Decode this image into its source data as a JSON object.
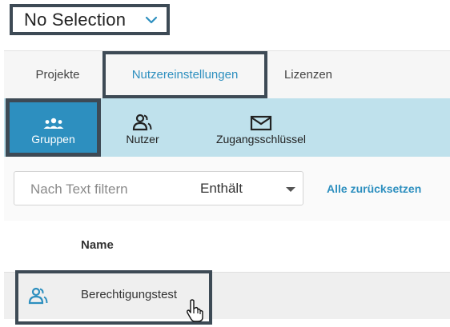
{
  "selection": {
    "label": "No Selection",
    "icon": "chevron-down-icon"
  },
  "tabs": [
    {
      "label": "Projekte",
      "active": false
    },
    {
      "label": "Nutzereinstellungen",
      "active": true
    },
    {
      "label": "Lizenzen",
      "active": false
    }
  ],
  "subtabs": [
    {
      "label": "Gruppen",
      "icon": "group-icon",
      "active": true
    },
    {
      "label": "Nutzer",
      "icon": "user-icon",
      "active": false
    },
    {
      "label": "Zugangsschlüssel",
      "icon": "envelope-icon",
      "active": false
    }
  ],
  "filter": {
    "placeholder": "Nach Text filtern",
    "operator": "Enthält",
    "reset_label": "Alle zurücksetzen"
  },
  "table": {
    "columns": [
      "Name"
    ],
    "rows": [
      {
        "name": "Berechtigungstest",
        "icon": "users-icon"
      }
    ]
  },
  "colors": {
    "accent": "#2d8fbf",
    "subtab_bar": "#bfe1ec",
    "highlight_border": "#3d4a55"
  }
}
